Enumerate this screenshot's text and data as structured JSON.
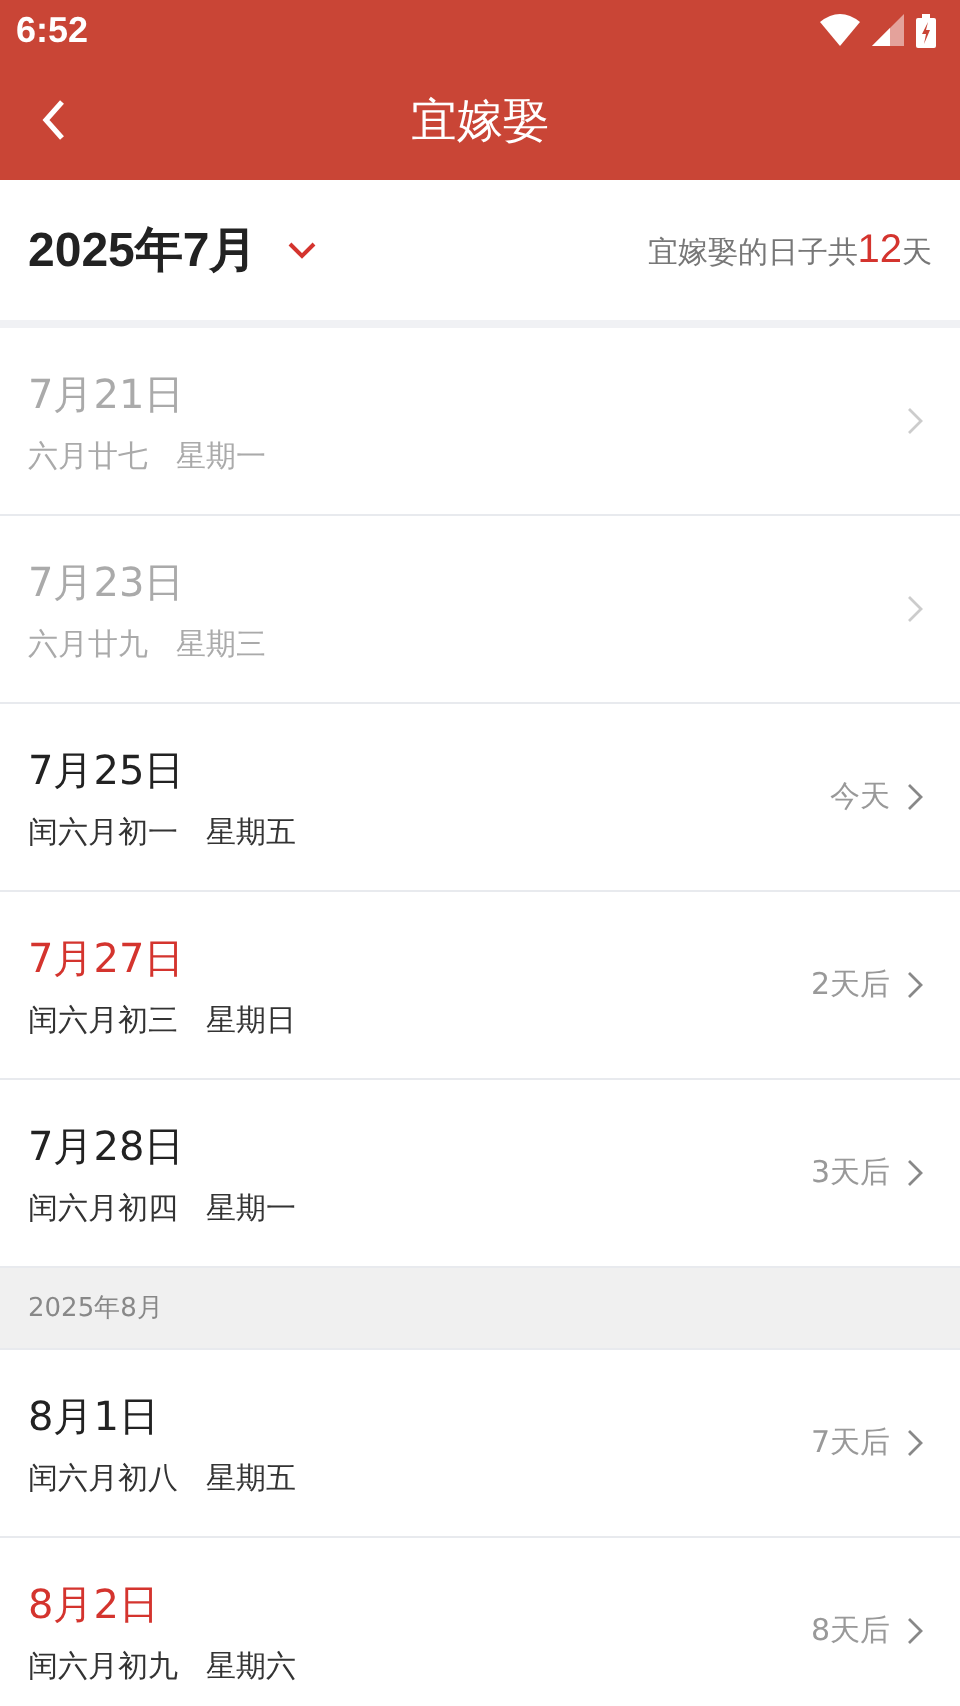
{
  "status_bar": {
    "time": "6:52"
  },
  "app_bar": {
    "title": "宜嫁娶"
  },
  "month_header": {
    "month": "2025年7月",
    "summary_prefix": "宜嫁娶的日子共",
    "summary_count": "12",
    "summary_suffix": "天"
  },
  "items": [
    {
      "kind": "day",
      "date": "7月21日",
      "lunar": "六月廿七",
      "weekday": "星期一",
      "past": true,
      "weekend": false
    },
    {
      "kind": "day",
      "date": "7月23日",
      "lunar": "六月廿九",
      "weekday": "星期三",
      "past": true,
      "weekend": false
    },
    {
      "kind": "day",
      "date": "7月25日",
      "lunar": "闰六月初一",
      "weekday": "星期五",
      "relative": "今天",
      "past": false,
      "weekend": false
    },
    {
      "kind": "day",
      "date": "7月27日",
      "lunar": "闰六月初三",
      "weekday": "星期日",
      "relative": "2天后",
      "past": false,
      "weekend": true
    },
    {
      "kind": "day",
      "date": "7月28日",
      "lunar": "闰六月初四",
      "weekday": "星期一",
      "relative": "3天后",
      "past": false,
      "weekend": false
    },
    {
      "kind": "section",
      "label": "2025年8月"
    },
    {
      "kind": "day",
      "date": "8月1日",
      "lunar": "闰六月初八",
      "weekday": "星期五",
      "relative": "7天后",
      "past": false,
      "weekend": false
    },
    {
      "kind": "day",
      "date": "8月2日",
      "lunar": "闰六月初九",
      "weekday": "星期六",
      "relative": "8天后",
      "past": false,
      "weekend": true
    }
  ]
}
